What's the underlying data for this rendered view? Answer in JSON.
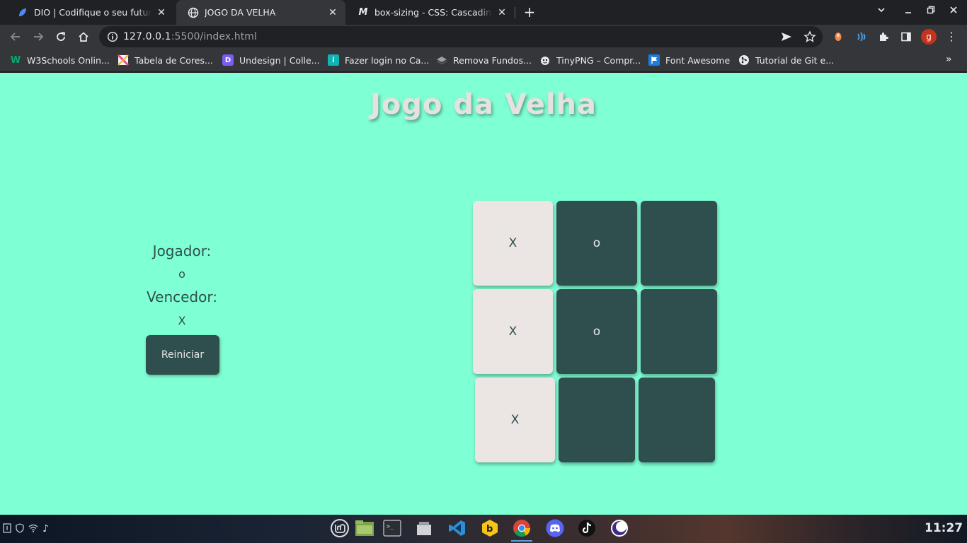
{
  "browser": {
    "tabs": [
      {
        "title": "DIO | Codifique o seu futuro global agora",
        "icon": "dio-icon",
        "active": false
      },
      {
        "title": "JOGO DA VELHA",
        "icon": "globe-icon",
        "active": true
      },
      {
        "title": "box-sizing - CSS: Cascading Style Sheets | MDN",
        "icon": "mdn-icon",
        "active": false
      }
    ],
    "new_tab_label": "+",
    "url_host": "127.0.0.1",
    "url_path": ":5500/index.html",
    "profile_initial": "g",
    "bookmarks": [
      {
        "label": "W3Schools Onlin...",
        "icon": "w3schools-icon"
      },
      {
        "label": "Tabela de Cores...",
        "icon": "color-table-icon"
      },
      {
        "label": "Undesign | Colle...",
        "icon": "undesign-icon"
      },
      {
        "label": "Fazer login no Ca...",
        "icon": "canva-icon"
      },
      {
        "label": "Remova Fundos...",
        "icon": "removebg-icon"
      },
      {
        "label": "TinyPNG – Compr...",
        "icon": "tinypng-icon"
      },
      {
        "label": "Font Awesome",
        "icon": "fontawesome-icon"
      },
      {
        "label": "Tutorial de Git e...",
        "icon": "git-icon"
      }
    ],
    "more_bookmarks": "»"
  },
  "game": {
    "title": "Jogo da Velha",
    "player_label": "Jogador:",
    "player_value": "o",
    "winner_label": "Vencedor:",
    "winner_value": "X",
    "restart_label": "Reiniciar",
    "board": [
      [
        "X",
        "o",
        ""
      ],
      [
        "X",
        "o",
        ""
      ],
      [
        "X",
        "",
        ""
      ]
    ],
    "colors": {
      "background": "#7fffd4",
      "dark": "#2f4f4f",
      "light": "#ebe6e4"
    }
  },
  "taskbar": {
    "apps": [
      "mint-menu-icon",
      "files-icon",
      "terminal-icon",
      "file-manager-icon",
      "vscode-icon",
      "beekeeper-icon",
      "chrome-icon",
      "discord-icon",
      "tiktok-icon",
      "eclipse-icon"
    ],
    "clock": "11:27"
  }
}
